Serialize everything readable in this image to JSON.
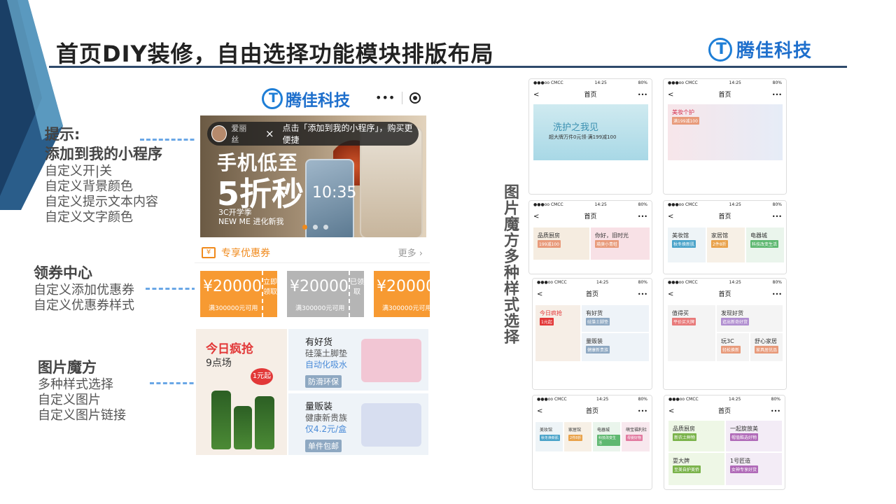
{
  "slide": {
    "title": "首页DIY装修，自由选择功能模块排版布局",
    "logo_text": "腾佳科技",
    "vertical_label": [
      "图",
      "片",
      "魔",
      "方",
      "多",
      "种",
      "样",
      "式",
      "选",
      "择"
    ]
  },
  "notes": {
    "tip": {
      "heading1": "提示:",
      "heading2": "添加到我的小程序",
      "lines": [
        "自定义开|关",
        "自定义背景颜色",
        "自定义提示文本内容",
        "自定义文字颜色"
      ]
    },
    "coupon": {
      "heading": "领券中心",
      "lines": [
        "自定义添加优惠券",
        "自定义优惠券样式"
      ]
    },
    "magic": {
      "heading": "图片魔方",
      "lines": [
        "多种样式选择",
        "自定义图片",
        "自定义图片链接"
      ]
    }
  },
  "phone": {
    "logo_text": "腾佳科技",
    "capsule_more": "•••",
    "banner": {
      "line1": "手机低至",
      "line2": "5折秒",
      "small1": "3C开学季",
      "small2": "NEW ME 进化新我",
      "phone_time": "10:35"
    },
    "toast": {
      "name": "爱丽丝",
      "close": "×",
      "message": "点击「添加到我的小程序」，购买更便捷"
    },
    "coupon_bar": {
      "icon": "¥",
      "label": "专享优惠券",
      "more": "更多 ›"
    },
    "coupons": [
      {
        "amount": "¥20000",
        "cond": "满300000元可用",
        "side": "立即领取",
        "state": "org"
      },
      {
        "amount": "¥20000",
        "cond": "满300000元可用",
        "side": "已领取",
        "state": "gry"
      },
      {
        "amount": "¥20000",
        "cond": "满300000元可用",
        "side": "",
        "state": "org"
      }
    ],
    "magic": {
      "left_title": "今日疯抢",
      "left_sub": "9点场",
      "left_badge": "1元起",
      "right": [
        {
          "head": "有好货",
          "d1": "硅藻土脚垫",
          "d2": "自动化吸水",
          "tag": "防滑环保"
        },
        {
          "head": "量贩装",
          "d1": "健康新贵族",
          "d2": "仅4.2元/盒",
          "tag": "单件包邮"
        }
      ]
    }
  },
  "thumbnails": [
    {
      "carrier": "●●●oo CMCC",
      "time": "14:25",
      "battery": "80%",
      "nav": "首页",
      "cells": [
        {
          "h": "",
          "big": "洗护之我见",
          "sm": "超大牌万件0元领·满199减100"
        }
      ]
    },
    {
      "carrier": "●●●oo CMCC",
      "time": "14:25",
      "battery": "80%",
      "nav": "首页",
      "cells": [
        {
          "h": "美妆个护",
          "s": "满199减100"
        }
      ]
    },
    {
      "carrier": "●●●oo CMCC",
      "time": "14:25",
      "battery": "80%",
      "nav": "首页",
      "cells": [
        {
          "h": "品质厨房",
          "s": "199减100"
        },
        {
          "h": "你好，旧时光",
          "s": "瑛庚小青蛙"
        }
      ]
    },
    {
      "carrier": "●●●oo CMCC",
      "time": "14:25",
      "battery": "80%",
      "nav": "首页",
      "cells": [
        {
          "h": "美妆馆",
          "s": "秋冬焕新肌"
        },
        {
          "h": "家居馆",
          "s": "2件8折"
        },
        {
          "h": "电器城",
          "s": "科技改变生活"
        }
      ]
    },
    {
      "carrier": "●●●oo CMCC",
      "time": "14:25",
      "battery": "80%",
      "nav": "首页",
      "cells": [
        {
          "h": "今日疯抢",
          "s": "1元起"
        },
        {
          "h": "有好货",
          "s": "硅藻土脚垫"
        },
        {
          "h": "量贩装",
          "s": "健康新贵族"
        }
      ]
    },
    {
      "carrier": "●●●oo CMCC",
      "time": "14:25",
      "battery": "80%",
      "nav": "首页",
      "cells": [
        {
          "h": "值得买",
          "s": "平价买大牌"
        },
        {
          "h": "发现好货",
          "s": "逛出新奇好货"
        },
        {
          "h": "玩3C",
          "s": "轻松换新"
        },
        {
          "h": "舒心家居",
          "s": "家具居优品"
        }
      ]
    },
    {
      "carrier": "●●●oo CMCC",
      "time": "14:25",
      "battery": "80%",
      "nav": "首页",
      "cells": [
        {
          "h": "美妆馆",
          "s": "秋冬焕新肌"
        },
        {
          "h": "家居馆",
          "s": "2件8折"
        },
        {
          "h": "电器城",
          "s": "科技改变生活"
        },
        {
          "h": "萌宝福利社",
          "s": "母婴好物"
        }
      ]
    },
    {
      "carrier": "●●●oo CMCC",
      "time": "14:25",
      "battery": "80%",
      "nav": "首页",
      "cells": [
        {
          "h": "品质厨房",
          "s": "新农土鲜物"
        },
        {
          "h": "一起旋放美",
          "s": "帽值酷选好物"
        },
        {
          "h": "耍大牌",
          "s": "至美自护美侨"
        },
        {
          "h": "1号匠造",
          "s": "女神专享好货"
        }
      ]
    }
  ]
}
